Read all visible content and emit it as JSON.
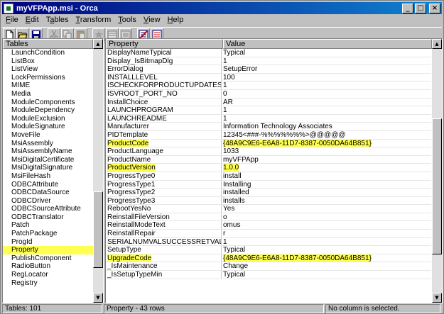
{
  "window": {
    "title": "myVFPApp.msi - Orca"
  },
  "menu": [
    {
      "pre": "",
      "ul": "F",
      "post": "ile"
    },
    {
      "pre": "",
      "ul": "E",
      "post": "dit"
    },
    {
      "pre": "T",
      "ul": "a",
      "post": "bles"
    },
    {
      "pre": "",
      "ul": "T",
      "post": "ransform"
    },
    {
      "pre": "",
      "ul": "T",
      "post": "ools"
    },
    {
      "pre": "",
      "ul": "V",
      "post": "iew"
    },
    {
      "pre": "",
      "ul": "H",
      "post": "elp"
    }
  ],
  "toolbar": {
    "icons": [
      "new-file-icon",
      "open-folder-icon",
      "save-icon",
      "cut-icon",
      "copy-icon",
      "paste-icon",
      "add-row-icon",
      "find-icon",
      "list-icon",
      "validate-icon",
      "transform-icon"
    ]
  },
  "tables_pane": {
    "header": "Tables",
    "selected": "Property",
    "items": [
      "LaunchCondition",
      "ListBox",
      "ListView",
      "LockPermissions",
      "MIME",
      "Media",
      "ModuleComponents",
      "ModuleDependency",
      "ModuleExclusion",
      "ModuleSignature",
      "MoveFile",
      "MsiAssembly",
      "MsiAssemblyName",
      "MsiDigitalCertificate",
      "MsiDigitalSignature",
      "MsiFileHash",
      "ODBCAttribute",
      "ODBCDataSource",
      "ODBCDriver",
      "ODBCSourceAttribute",
      "ODBCTranslator",
      "Patch",
      "PatchPackage",
      "ProgId",
      "Property",
      "PublishComponent",
      "RadioButton",
      "RegLocator",
      "Registry"
    ]
  },
  "props_pane": {
    "header_property": "Property",
    "header_value": "Value",
    "rows": [
      {
        "p": "DisplayNameTypical",
        "v": "Typical"
      },
      {
        "p": "Display_IsBitmapDlg",
        "v": "1"
      },
      {
        "p": "ErrorDialog",
        "v": "SetupError"
      },
      {
        "p": "INSTALLLEVEL",
        "v": "100"
      },
      {
        "p": "ISCHECKFORPRODUCTUPDATES",
        "v": "1"
      },
      {
        "p": "ISVROOT_PORT_NO",
        "v": "0"
      },
      {
        "p": "InstallChoice",
        "v": "AR"
      },
      {
        "p": "LAUNCHPROGRAM",
        "v": "1"
      },
      {
        "p": "LAUNCHREADME",
        "v": "1"
      },
      {
        "p": "Manufacturer",
        "v": "Information Technology Associates"
      },
      {
        "p": "PIDTemplate",
        "v": "12345<###-%%%%%%%>@@@@@"
      },
      {
        "p": "ProductCode",
        "v": "{48A9C9E6-E6A8-11D7-8387-0050DA64B851}",
        "hl": true
      },
      {
        "p": "ProductLanguage",
        "v": "1033"
      },
      {
        "p": "ProductName",
        "v": "myVFPApp"
      },
      {
        "p": "ProductVersion",
        "v": "1.0.0",
        "hl": true
      },
      {
        "p": "ProgressType0",
        "v": "install"
      },
      {
        "p": "ProgressType1",
        "v": "Installing"
      },
      {
        "p": "ProgressType2",
        "v": "installed"
      },
      {
        "p": "ProgressType3",
        "v": "installs"
      },
      {
        "p": "RebootYesNo",
        "v": "Yes"
      },
      {
        "p": "ReinstallFileVersion",
        "v": "o"
      },
      {
        "p": "ReinstallModeText",
        "v": "omus"
      },
      {
        "p": "ReinstallRepair",
        "v": "r"
      },
      {
        "p": "SERIALNUMVALSUCCESSRETVAL",
        "v": "1"
      },
      {
        "p": "SetupType",
        "v": "Typical"
      },
      {
        "p": "UpgradeCode",
        "v": "{48A9C9E6-E6A8-11D7-8387-0050DA64B851}",
        "hl": true
      },
      {
        "p": "_IsMaintenance",
        "v": "Change"
      },
      {
        "p": "_IsSetupTypeMin",
        "v": "Typical"
      }
    ]
  },
  "status": {
    "tables_count": "Tables: 101",
    "rows_info": "Property - 43 rows",
    "column_info": "No column is selected."
  },
  "colors": {
    "highlight": "#ffff50",
    "title_start": "#000080",
    "title_end": "#1084d0"
  }
}
